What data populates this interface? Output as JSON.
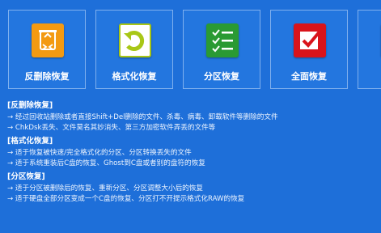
{
  "tiles": [
    {
      "label": "反删除恢复",
      "icon": "recycle-bin-icon",
      "color": "#f39a12"
    },
    {
      "label": "格式化恢复",
      "icon": "format-arrow-icon",
      "color": "#a8c716"
    },
    {
      "label": "分区恢复",
      "icon": "checklist-icon",
      "color": "#2a9a33"
    },
    {
      "label": "全面恢复",
      "icon": "checkbox-icon",
      "color": "#d9141b"
    },
    {
      "label": "",
      "icon": "partial-tile-icon",
      "color": "#7a26b8"
    }
  ],
  "sections": [
    {
      "title": "[反删除恢复]",
      "items": [
        "→ 经过回收站删除或者直接Shift+Del删除的文件、杀毒、病毒、卸载软件等删除的文件",
        "→ ChkDsk丢失、文件莫名其妙消失、第三方加密软件弄丢的文件等"
      ]
    },
    {
      "title": "[格式化恢复]",
      "items": [
        "→ 适于恢复被快速/完全格式化的分区、分区转换丢失的文件",
        "→ 适于系统重装后C盘的恢复、Ghost到C盘或者别的盘符的恢复"
      ]
    },
    {
      "title": "[分区恢复]",
      "items": [
        "→ 适于分区被删除后的恢复、重新分区、分区调整大小后的恢复",
        "→ 适于硬盘全部分区变成一个C盘的恢复、分区打不开提示格式化RAW的恢复"
      ]
    }
  ]
}
